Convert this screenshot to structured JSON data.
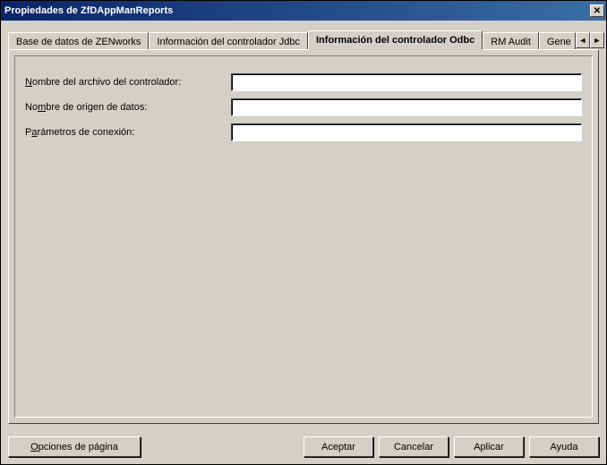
{
  "window": {
    "title": "Propiedades de ZfDAppManReports"
  },
  "tabs": {
    "db": "Base de datos de ZENworks",
    "jdbc": "Información del controlador Jdbc",
    "odbc": "Información del controlador Odbc",
    "rmaudit": "RM Audit",
    "gene": "Gene"
  },
  "form": {
    "driverFileLabelPrefix": "N",
    "driverFileLabelRest": "ombre del archivo del controlador:",
    "driverFileValue": "",
    "dsnLabelPrefix": "No",
    "dsnLabelUnder": "m",
    "dsnLabelRest": "bre de origen de datos:",
    "dsnValue": "",
    "connLabelPrefix": "P",
    "connLabelUnder": "a",
    "connLabelRest": "rámetros de conexión:",
    "connValue": ""
  },
  "buttons": {
    "pageOptionsUnder": "O",
    "pageOptionsRest": "pciones de página",
    "ok": "Aceptar",
    "cancel": "Cancelar",
    "apply": "Aplicar",
    "help": "Ayuda"
  },
  "icons": {
    "close": "✕",
    "left": "◄",
    "right": "►"
  }
}
